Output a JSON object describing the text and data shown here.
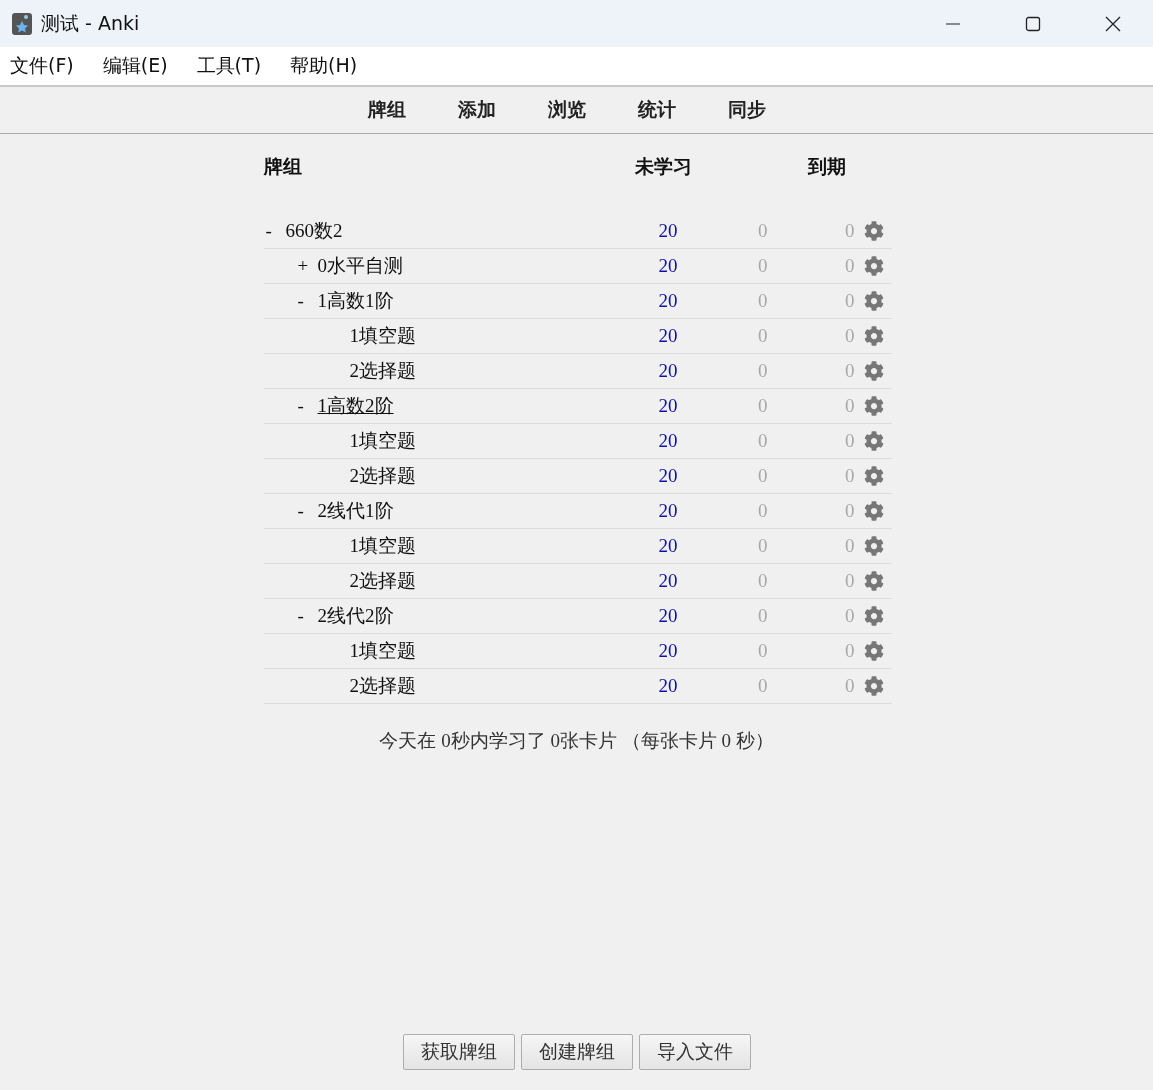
{
  "window": {
    "title": "测试 - Anki"
  },
  "menu": [
    "文件(F)",
    "编辑(E)",
    "工具(T)",
    "帮助(H)"
  ],
  "toolbar": [
    "牌组",
    "添加",
    "浏览",
    "统计",
    "同步"
  ],
  "table": {
    "columns": [
      "牌组",
      "未学习",
      "到期"
    ],
    "decks": [
      {
        "name": "660数2",
        "toggle": "-",
        "current": false,
        "new": "20",
        "learning": "0",
        "due": "0",
        "children": [
          {
            "name": "0水平自测",
            "toggle": "+",
            "current": false,
            "new": "20",
            "learning": "0",
            "due": "0"
          },
          {
            "name": "1高数1阶",
            "toggle": "-",
            "current": false,
            "new": "20",
            "learning": "0",
            "due": "0",
            "children": [
              {
                "name": "1填空题",
                "current": false,
                "new": "20",
                "learning": "0",
                "due": "0"
              },
              {
                "name": "2选择题",
                "current": false,
                "new": "20",
                "learning": "0",
                "due": "0"
              }
            ]
          },
          {
            "name": "1高数2阶",
            "toggle": "-",
            "current": true,
            "new": "20",
            "learning": "0",
            "due": "0",
            "children": [
              {
                "name": "1填空题",
                "current": false,
                "new": "20",
                "learning": "0",
                "due": "0"
              },
              {
                "name": "2选择题",
                "current": false,
                "new": "20",
                "learning": "0",
                "due": "0"
              }
            ]
          },
          {
            "name": "2线代1阶",
            "toggle": "-",
            "current": false,
            "new": "20",
            "learning": "0",
            "due": "0",
            "children": [
              {
                "name": "1填空题",
                "current": false,
                "new": "20",
                "learning": "0",
                "due": "0"
              },
              {
                "name": "2选择题",
                "current": false,
                "new": "20",
                "learning": "0",
                "due": "0"
              }
            ]
          },
          {
            "name": "2线代2阶",
            "toggle": "-",
            "current": false,
            "new": "20",
            "learning": "0",
            "due": "0",
            "children": [
              {
                "name": "1填空题",
                "current": false,
                "new": "20",
                "learning": "0",
                "due": "0"
              },
              {
                "name": "2选择题",
                "current": false,
                "new": "20",
                "learning": "0",
                "due": "0"
              }
            ]
          }
        ]
      }
    ]
  },
  "summary": "今天在 0秒内学习了 0张卡片 （每张卡片 0 秒）",
  "buttons": [
    "获取牌组",
    "创建牌组",
    "导入文件"
  ]
}
